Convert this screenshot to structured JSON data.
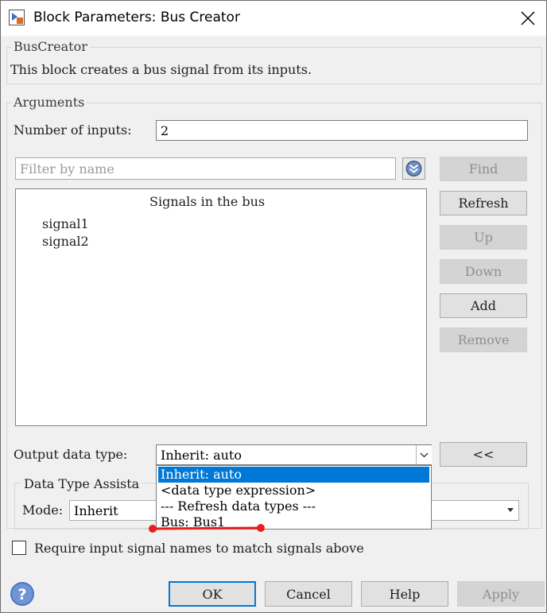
{
  "window": {
    "title": "Block Parameters: Bus Creator"
  },
  "block": {
    "name": "BusCreator",
    "description": "This block creates a bus signal from its inputs."
  },
  "arguments": {
    "header": "Arguments",
    "num_inputs_label": "Number of inputs:",
    "num_inputs_value": "2",
    "filter_placeholder": "Filter by name",
    "signals_header": "Signals in the bus",
    "signals": [
      "signal1",
      "signal2"
    ]
  },
  "side_buttons": {
    "find": "Find",
    "refresh": "Refresh",
    "up": "Up",
    "down": "Down",
    "add": "Add",
    "remove": "Remove",
    "assistant": "<<"
  },
  "output_type": {
    "label": "Output data type:",
    "value": "Inherit: auto",
    "options": [
      "Inherit: auto",
      "<data type expression>",
      "--- Refresh data types ---",
      "Bus: Bus1"
    ]
  },
  "assistant": {
    "header": "Data Type Assista",
    "mode_label": "Mode:",
    "mode_value": "Inherit"
  },
  "require_names": {
    "label": "Require input signal names to match signals above",
    "checked": false
  },
  "footer": {
    "ok": "OK",
    "cancel": "Cancel",
    "help": "Help",
    "apply": "Apply"
  },
  "colors": {
    "accent": "#0078d7",
    "annotation": "#e8201c",
    "help_icon": "#4a78c2"
  }
}
